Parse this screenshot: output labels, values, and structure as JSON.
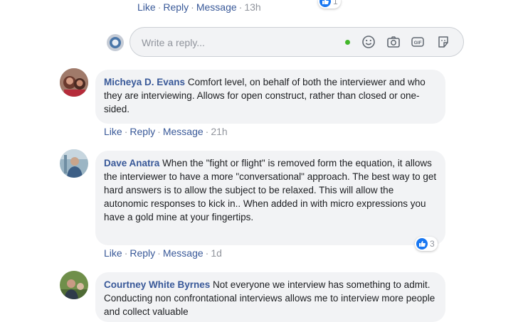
{
  "top_comment": {
    "actions": {
      "like": "Like",
      "reply": "Reply",
      "message": "Message",
      "time": "13h"
    },
    "reaction_count": "1"
  },
  "reply_box": {
    "placeholder": "Write a reply..."
  },
  "comments": [
    {
      "author": "Micheya D. Evans",
      "text": "Comfort level, on behalf of both the interviewer and who they are interviewing. Allows for open construct, rather than closed or one-sided.",
      "actions": {
        "like": "Like",
        "reply": "Reply",
        "message": "Message",
        "time": "21h"
      }
    },
    {
      "author": "Dave Anatra",
      "text": "When the \"fight or flight\" is removed form the equation, it allows the interviewer to have a more \"conversational\" approach. The best way to get hard answers is to allow the subject to be relaxed. This will allow the autonomic responses to kick in.. When added in with micro expressions you have a gold mine at your fingertips.",
      "actions": {
        "like": "Like",
        "reply": "Reply",
        "message": "Message",
        "time": "1d"
      },
      "reaction_count": "3"
    },
    {
      "author": "Courtney White Byrnes",
      "text": "Not everyone we interview has something to admit. Conducting non confrontational interviews allows me to interview more people and collect valuable"
    }
  ],
  "colors": {
    "link": "#385898",
    "meta": "#90949c",
    "bubble": "#f2f3f5",
    "like_blue": "#1877f2",
    "online": "#42b72a"
  }
}
